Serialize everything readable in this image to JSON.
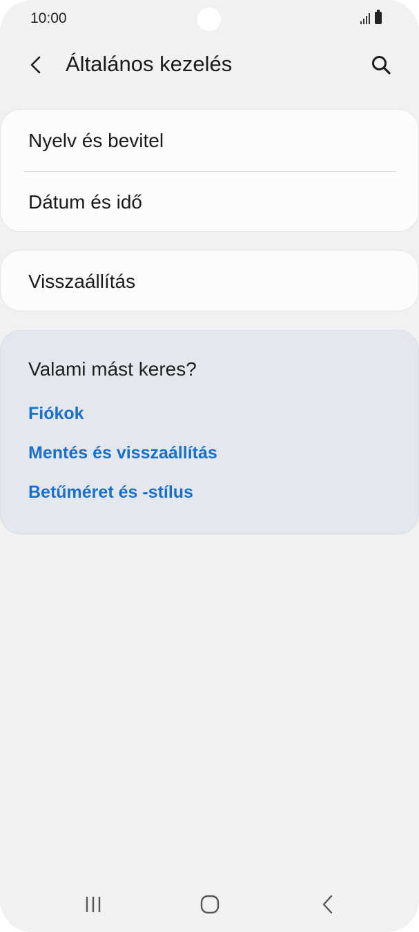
{
  "status_bar": {
    "time": "10:00",
    "icons": [
      "signal-icon",
      "battery-icon"
    ]
  },
  "header": {
    "title": "Általános kezelés",
    "back_icon": "chevron-left-icon",
    "search_icon": "search-icon"
  },
  "settings_group_1": {
    "items": [
      {
        "label": "Nyelv és bevitel"
      },
      {
        "label": "Dátum és idő"
      }
    ]
  },
  "settings_group_2": {
    "items": [
      {
        "label": "Visszaállítás"
      }
    ]
  },
  "suggestions": {
    "title": "Valami mást keres?",
    "links": [
      {
        "label": "Fiókok"
      },
      {
        "label": "Mentés és visszaállítás"
      },
      {
        "label": "Betűméret és -stílus"
      }
    ],
    "link_color": "#1a6fc9"
  },
  "nav_bar": {
    "buttons": [
      "recent-apps-icon",
      "home-icon",
      "back-icon"
    ]
  }
}
